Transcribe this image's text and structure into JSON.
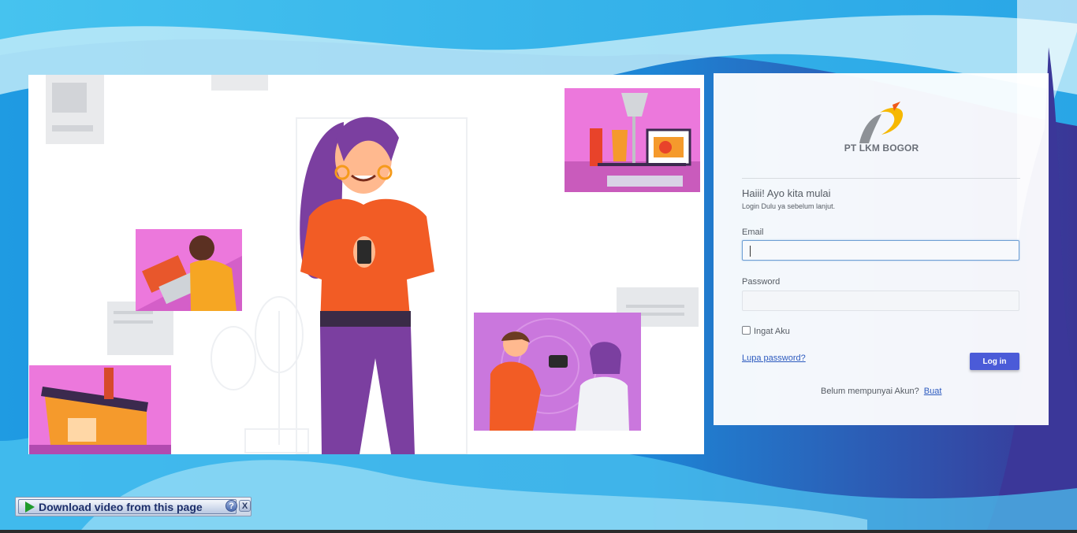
{
  "brand": {
    "name": "PT LKM BOGOR"
  },
  "login": {
    "greeting": "Haiii! Ayo kita mulai",
    "subgreeting": "Login Dulu ya sebelum lanjut.",
    "email_label": "Email",
    "email_value": "",
    "password_label": "Password",
    "password_value": "",
    "remember_label": "Ingat Aku",
    "remember_checked": false,
    "forgot_label": "Lupa password?",
    "login_button": "Log in",
    "register_prompt": "Belum mempunyai Akun?",
    "register_link": "Buat"
  },
  "download_bar": {
    "button_label": "Download video from this page",
    "help_label": "?",
    "close_label": "X"
  },
  "icons": [
    "logo-icon",
    "play-icon",
    "help-icon",
    "close-icon"
  ],
  "colors": {
    "accent": "#4b5bd8",
    "link": "#2d5bbf",
    "background_blue": "#1a8fd8",
    "background_purple": "#3b3a9b"
  }
}
